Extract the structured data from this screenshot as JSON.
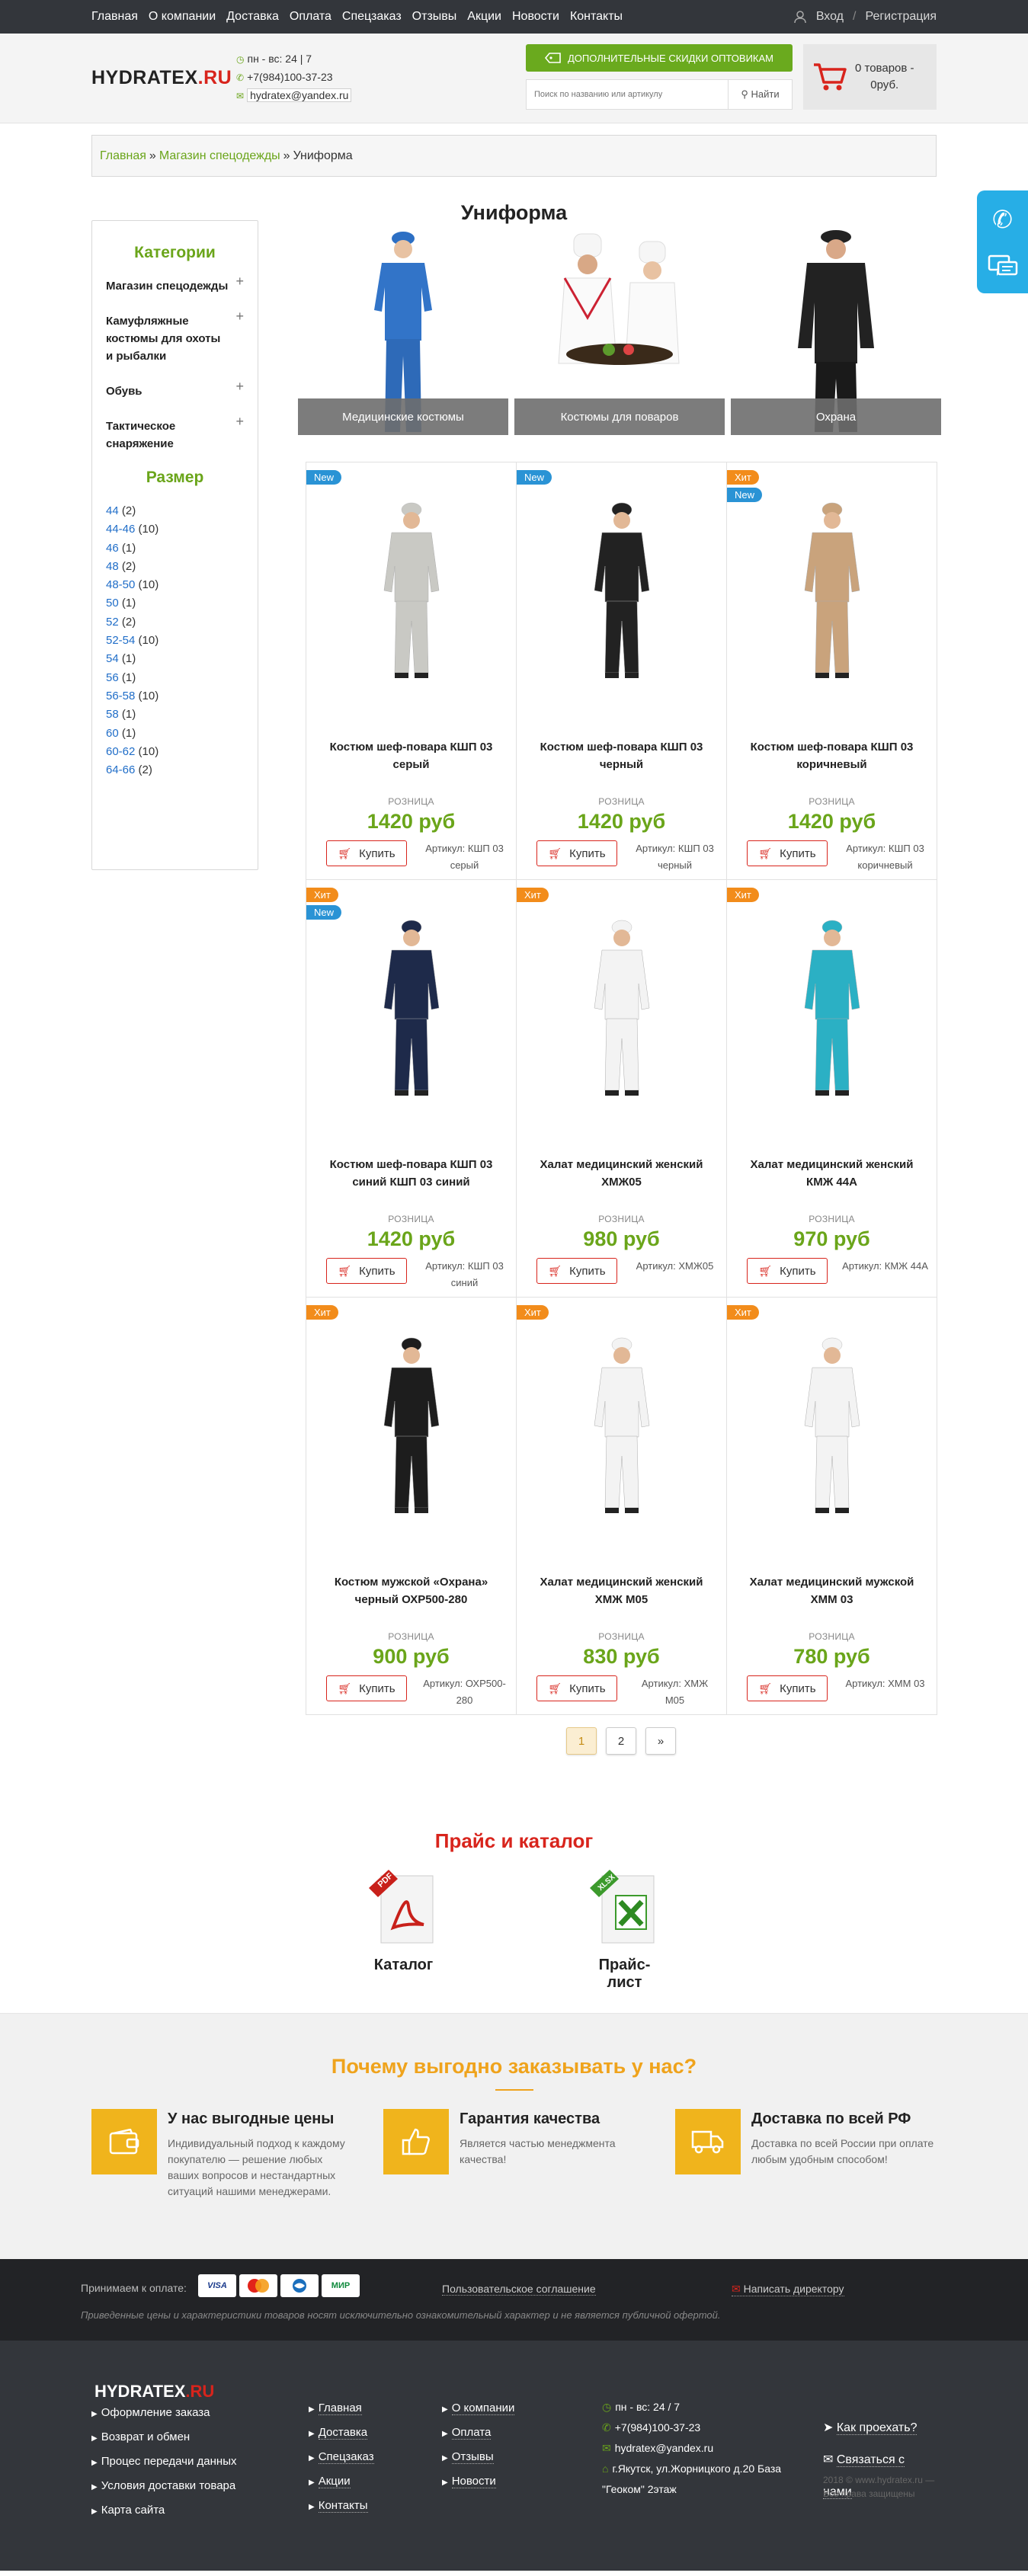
{
  "topnav": [
    "Главная",
    "О компании",
    "Доставка",
    "Оплата",
    "Спецзаказ",
    "Отзывы",
    "Акции",
    "Новости",
    "Контакты"
  ],
  "auth": {
    "login": "Вход",
    "sep": "/",
    "register": "Регистрация"
  },
  "header": {
    "logo_main": "HYDRATEX",
    "logo_ru": ".RU",
    "hours": "пн - вс: 24 | 7",
    "phone": "+7(984)100-37-23",
    "email": "hydratex@yandex.ru",
    "discount_label": "ДОПОЛНИТЕЛЬНЫЕ СКИДКИ ОПТОВИКАМ",
    "search_placeholder": "Поиск по названию или артикулу",
    "search_button": "Найти",
    "cart_line1": "0 товаров -",
    "cart_line2": "0руб."
  },
  "breadcrumb": {
    "home": "Главная",
    "shop": "Магазин спецодежды",
    "sep": "»",
    "current": "Униформа"
  },
  "page_title": "Униформа",
  "sidebar": {
    "categories_title": "Категории",
    "categories": [
      {
        "label": "Магазин спецодежды",
        "toggle": "+"
      },
      {
        "label": "Камуфляжные костюмы для охоты и рыбалки",
        "toggle": "+"
      },
      {
        "label": "Обувь",
        "toggle": "+"
      },
      {
        "label": "Тактическое снаряжение",
        "toggle": "+"
      }
    ],
    "sizes_title": "Размер",
    "sizes": [
      {
        "size": "44",
        "count": "(2)"
      },
      {
        "size": "44-46",
        "count": "(10)"
      },
      {
        "size": "46",
        "count": "(1)"
      },
      {
        "size": "48",
        "count": "(2)"
      },
      {
        "size": "48-50",
        "count": "(10)"
      },
      {
        "size": "50",
        "count": "(1)"
      },
      {
        "size": "52",
        "count": "(2)"
      },
      {
        "size": "52-54",
        "count": "(10)"
      },
      {
        "size": "54",
        "count": "(1)"
      },
      {
        "size": "56",
        "count": "(1)"
      },
      {
        "size": "56-58",
        "count": "(10)"
      },
      {
        "size": "58",
        "count": "(1)"
      },
      {
        "size": "60",
        "count": "(1)"
      },
      {
        "size": "60-62",
        "count": "(10)"
      },
      {
        "size": "64-66",
        "count": "(2)"
      }
    ]
  },
  "subcategories": [
    "Медицинские костюмы",
    "Костюмы для поваров",
    "Охрана"
  ],
  "retail_label": "РОЗНИЦА",
  "buy_label": "Купить",
  "products": [
    {
      "name": "Костюм шеф-повара КШП 03 серый",
      "price": "1420 руб",
      "sku": "Артикул: КШП 03 серый",
      "badges": [
        "New"
      ],
      "color": "#c9c9c4"
    },
    {
      "name": "Костюм шеф-повара КШП 03 черный",
      "price": "1420 руб",
      "sku": "Артикул: КШП 03 черный",
      "badges": [
        "New"
      ],
      "color": "#222222"
    },
    {
      "name": "Костюм шеф-повара КШП 03 коричневый",
      "price": "1420 руб",
      "sku": "Артикул: КШП 03 коричневый",
      "badges": [
        "Хит",
        "New"
      ],
      "color": "#c9a37c"
    },
    {
      "name": "Костюм шеф-повара КШП 03 синий КШП 03 синий",
      "price": "1420 руб",
      "sku": "Артикул: КШП 03 синий",
      "badges": [
        "Хит",
        "New"
      ],
      "color": "#1e2a4a"
    },
    {
      "name": "Халат медицинский женский ХМЖ05",
      "price": "980 руб",
      "sku": "Артикул: ХМЖ05",
      "badges": [
        "Хит"
      ],
      "color": "#f3f3f3"
    },
    {
      "name": "Халат медицинский женский КМЖ 44А",
      "price": "970 руб",
      "sku": "Артикул: КМЖ 44А",
      "badges": [
        "Хит"
      ],
      "color": "#2bb0c4"
    },
    {
      "name": "Костюм мужской «Охрана» черный ОХР500-280",
      "price": "900 руб",
      "sku": "Артикул: ОХР500-280",
      "badges": [
        "Хит"
      ],
      "color": "#1d1d1d"
    },
    {
      "name": "Халат медицинский женский ХМЖ М05",
      "price": "830 руб",
      "sku": "Артикул: ХМЖ М05",
      "badges": [
        "Хит"
      ],
      "color": "#f3f3f3"
    },
    {
      "name": "Халат медицинский мужской ХММ 03",
      "price": "780 руб",
      "sku": "Артикул: ХММ 03",
      "badges": [
        "Хит"
      ],
      "color": "#f3f3f3"
    }
  ],
  "pagination": [
    "1",
    "2",
    "»"
  ],
  "price_catalog": {
    "title": "Прайс и каталог",
    "catalog": "Каталог",
    "pricelist": "Прайс-лист",
    "pdf_tag": "PDF",
    "xlsx_tag": "XLSX"
  },
  "why": {
    "title": "Почему выгодно заказывать у нас?",
    "items": [
      {
        "title": "У нас выгодные цены",
        "text": "Индивидуальный подход к каждому покупателю — решение любых ваших вопросов и нестандартных ситуаций нашими менеджерами.",
        "icon": "wallet-icon"
      },
      {
        "title": "Гарантия качества",
        "text": "Является частью менеджмента качества!",
        "icon": "thumbs-up-icon"
      },
      {
        "title": "Доставка по всей РФ",
        "text": "Доставка по всей России при оплате любым удобным способом!",
        "icon": "truck-icon"
      }
    ]
  },
  "paybar": {
    "accept": "Принимаем к оплате:",
    "cards": [
      "VISA",
      "MC",
      "",
      "МИР"
    ],
    "agreement": "Пользовательское соглашение",
    "director": "Написать директору",
    "disclaimer": "Приведенные цены и характеристики товаров носят исключительно ознакомительный характер и не является публичной офертой."
  },
  "footer": {
    "logo_main": "HYDRATEX",
    "logo_ru": ".RU",
    "col1": [
      "Оформление заказа",
      "Возврат и обмен",
      "Процес передачи данных",
      "Условия доставки товара",
      "Карта сайта"
    ],
    "col2": [
      "Главная",
      "Доставка",
      "Спецзаказ",
      "Акции",
      "Контакты"
    ],
    "col3": [
      "О компании",
      "Оплата",
      "Отзывы",
      "Новости"
    ],
    "hours": "пн - вс: 24 / 7",
    "phone": "+7(984)100-37-23",
    "email": "hydratex@yandex.ru",
    "address": "г.Якутск, ул.Жорницкого д.20 База \"Геоком\" 2этаж",
    "route": "Как проехать?",
    "contact_us": "Связаться с нами",
    "copyright": "2018 © www.hydratex.ru — Все права защищены"
  },
  "colors": {
    "accent_green": "#6aa51a",
    "accent_red": "#d8241c",
    "accent_orange": "#efa31c",
    "dark": "#33363b",
    "badge_new": "#2a93d5",
    "badge_hit": "#f28c1b",
    "side_widget": "#27aee6"
  }
}
